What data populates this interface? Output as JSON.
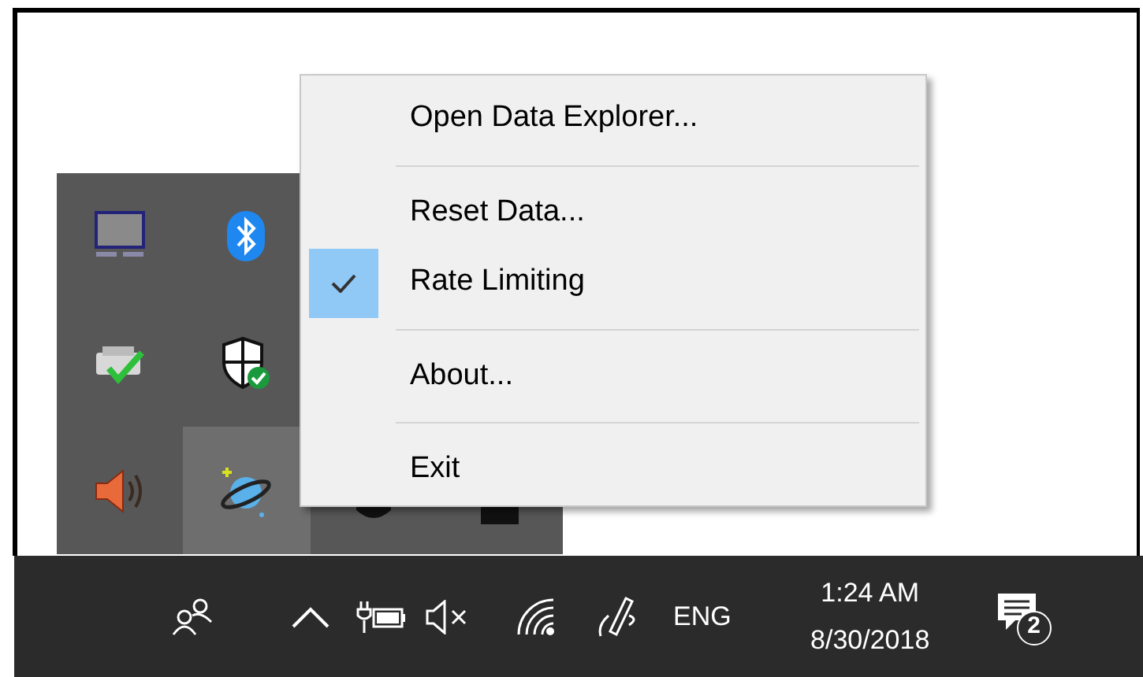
{
  "context_menu": {
    "items": [
      {
        "kind": "item",
        "label": "Open Data Explorer...",
        "checked": false
      },
      {
        "kind": "separator"
      },
      {
        "kind": "item",
        "label": "Reset Data...",
        "checked": false
      },
      {
        "kind": "item",
        "label": "Rate Limiting",
        "checked": true
      },
      {
        "kind": "separator"
      },
      {
        "kind": "item",
        "label": "About...",
        "checked": false
      },
      {
        "kind": "separator"
      },
      {
        "kind": "item",
        "label": "Exit",
        "checked": false
      }
    ]
  },
  "taskbar": {
    "language": "ENG",
    "time": "1:24 AM",
    "date": "8/30/2018",
    "notification_count": "2"
  }
}
